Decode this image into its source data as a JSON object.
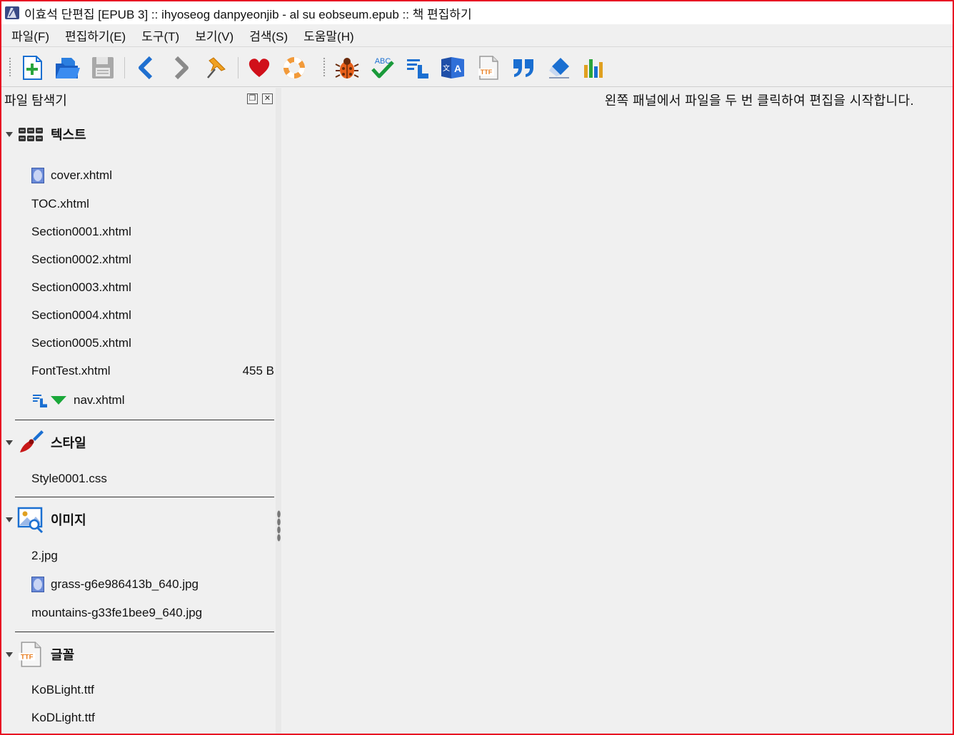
{
  "window": {
    "title": "이효석 단편집 [EPUB 3] :: ihyoseog danpyeonjib - al su eobseum.epub :: 책 편집하기",
    "border_color": "#e81123"
  },
  "menu": {
    "items": [
      {
        "label": "파일(F)"
      },
      {
        "label": "편집하기(E)"
      },
      {
        "label": "도구(T)"
      },
      {
        "label": "보기(V)"
      },
      {
        "label": "검색(S)"
      },
      {
        "label": "도움말(H)"
      }
    ]
  },
  "toolbar": {
    "buttons": [
      {
        "icon": "new-file-icon"
      },
      {
        "icon": "open-folder-icon"
      },
      {
        "icon": "save-icon"
      },
      {
        "icon": "back-arrow-icon"
      },
      {
        "icon": "forward-arrow-icon"
      },
      {
        "icon": "pin-icon"
      },
      {
        "icon": "heart-icon"
      },
      {
        "icon": "lifebuoy-icon"
      },
      {
        "icon": "bug-icon"
      },
      {
        "icon": "spellcheck-icon"
      },
      {
        "icon": "toc-icon"
      },
      {
        "icon": "translate-book-icon"
      },
      {
        "icon": "ttf-font-icon"
      },
      {
        "icon": "quote-icon"
      },
      {
        "icon": "eraser-icon"
      },
      {
        "icon": "reports-chart-icon"
      }
    ]
  },
  "file_browser": {
    "title": "파일 탐색기",
    "groups": {
      "text": {
        "label": "텍스트",
        "files": [
          {
            "name": "cover.xhtml"
          },
          {
            "name": "TOC.xhtml"
          },
          {
            "name": "Section0001.xhtml"
          },
          {
            "name": "Section0002.xhtml"
          },
          {
            "name": "Section0003.xhtml"
          },
          {
            "name": "Section0004.xhtml"
          },
          {
            "name": "Section0005.xhtml"
          },
          {
            "name": "FontTest.xhtml",
            "size": "455 B"
          },
          {
            "name": "nav.xhtml"
          }
        ]
      },
      "styles": {
        "label": "스타일",
        "files": [
          {
            "name": "Style0001.css"
          }
        ]
      },
      "images": {
        "label": "이미지",
        "files": [
          {
            "name": "2.jpg"
          },
          {
            "name": "grass-g6e986413b_640.jpg"
          },
          {
            "name": "mountains-g33fe1bee9_640.jpg"
          }
        ]
      },
      "fonts": {
        "label": "글꼴",
        "files": [
          {
            "name": "KoBLight.ttf"
          },
          {
            "name": "KoDLight.ttf"
          }
        ]
      }
    }
  },
  "editor": {
    "hint": "왼쪽 패널에서 파일을 두 번 클릭하여 편집을 시작합니다."
  }
}
